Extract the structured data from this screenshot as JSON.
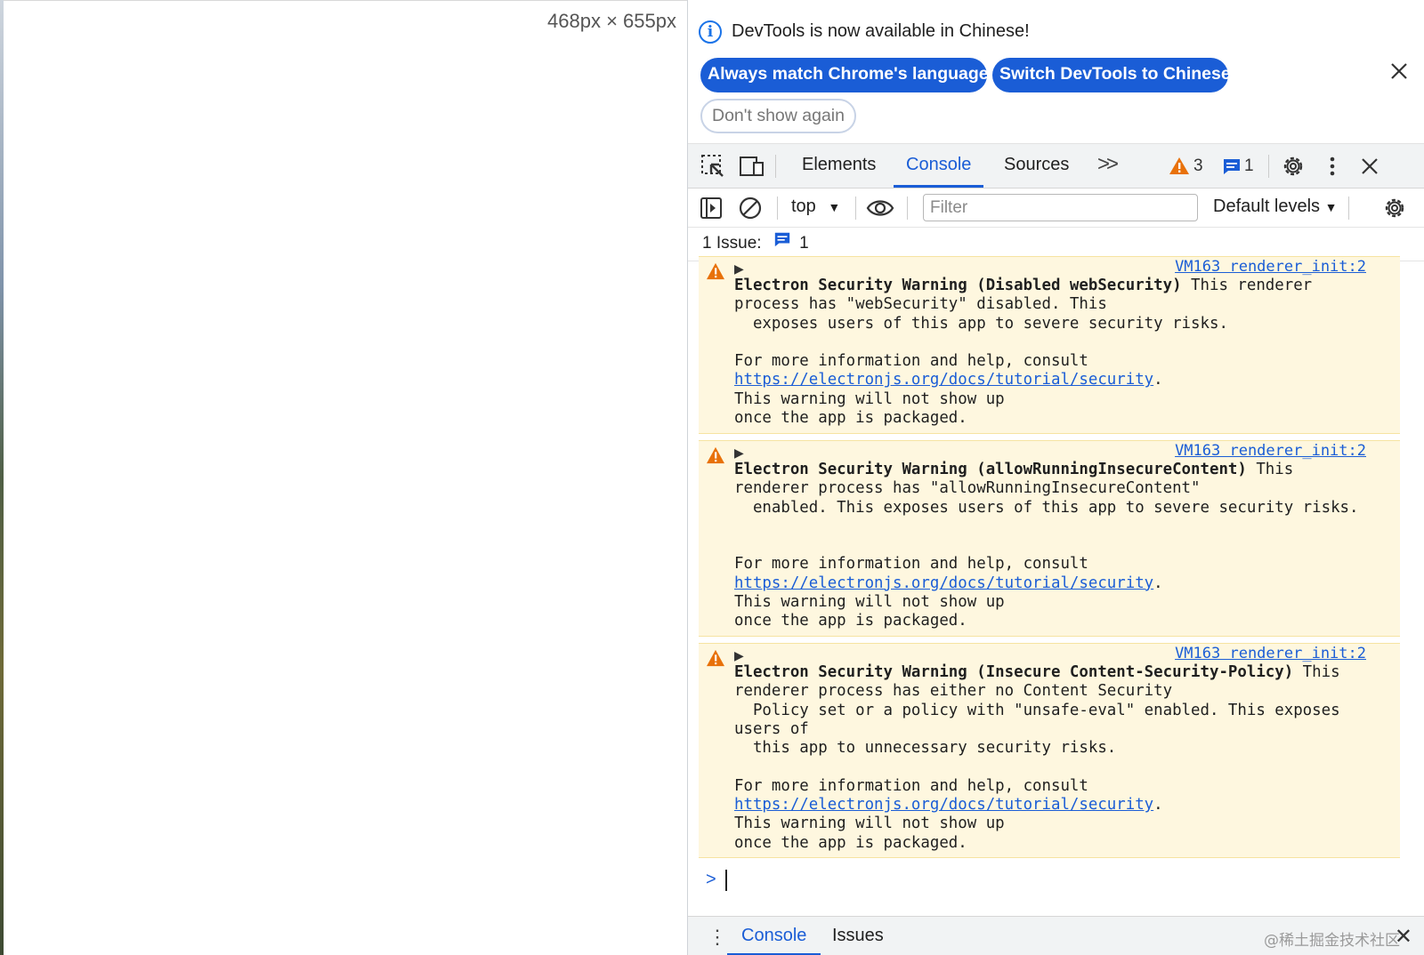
{
  "viewport": {
    "size_label": "468px × 655px"
  },
  "infobar": {
    "message": "DevTools is now available in Chinese!",
    "match_language_label": "Always match Chrome's language",
    "switch_label": "Switch DevTools to Chinese",
    "dont_show_label": "Don't show again",
    "icon": "info-icon",
    "close_icon": "close-icon"
  },
  "tabs": {
    "items": [
      "Elements",
      "Console",
      "Sources"
    ],
    "active": "Console",
    "more_label": ">>",
    "warnings_count": "3",
    "issues_count": "1"
  },
  "console_toolbar": {
    "context": "top",
    "filter_placeholder": "Filter",
    "levels": "Default levels"
  },
  "issues_bar": {
    "label": "1 Issue:",
    "count": "1"
  },
  "messages": [
    {
      "source": "VM163 renderer_init:2",
      "title": "Electron Security Warning (Disabled webSecurity)",
      "body_a": " This renderer\nprocess has \"webSecurity\" disabled. This\n  exposes users of this app to severe security risks.\n\nFor more information and help, consult\n",
      "link": "https://electronjs.org/docs/tutorial/security",
      "body_b": ".\nThis warning will not show up\nonce the app is packaged."
    },
    {
      "source": "VM163 renderer_init:2",
      "title": "Electron Security Warning (allowRunningInsecureContent)",
      "body_a": " This\nrenderer process has \"allowRunningInsecureContent\"\n  enabled. This exposes users of this app to severe security risks.\n\n\nFor more information and help, consult\n",
      "link": "https://electronjs.org/docs/tutorial/security",
      "body_b": ".\nThis warning will not show up\nonce the app is packaged."
    },
    {
      "source": "VM163 renderer_init:2",
      "title": "Electron Security Warning (Insecure Content-Security-Policy)",
      "body_a": " This\nrenderer process has either no Content Security\n  Policy set or a policy with \"unsafe-eval\" enabled. This exposes\nusers of\n  this app to unnecessary security risks.\n\nFor more information and help, consult\n",
      "link": "https://electronjs.org/docs/tutorial/security",
      "body_b": ".\nThis warning will not show up\nonce the app is packaged."
    }
  ],
  "prompt": {
    "symbol": ">"
  },
  "drawer": {
    "tabs": [
      "Console",
      "Issues"
    ],
    "active": "Console",
    "menu_label": "⋮",
    "close_label": "✕"
  },
  "watermark": "@稀土掘金技术社区",
  "colors": {
    "accent": "#1a5dd6",
    "warning_bg": "#fef7df",
    "warning_icon": "#e8710a"
  }
}
